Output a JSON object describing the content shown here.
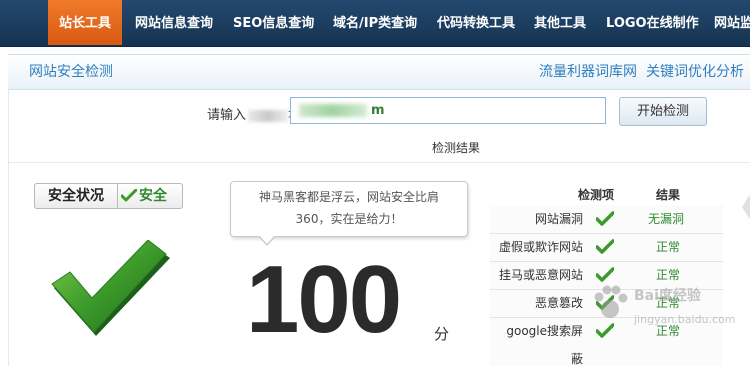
{
  "nav": {
    "items": [
      {
        "label": "站长工具",
        "active": true
      },
      {
        "label": "网站信息查询"
      },
      {
        "label": "SEO信息查询"
      },
      {
        "label": "域名/IP类查询"
      },
      {
        "label": "代码转换工具"
      },
      {
        "label": "其他工具"
      },
      {
        "label": "LOGO在线制作"
      },
      {
        "label": "网站监"
      }
    ]
  },
  "subhead": {
    "title": "网站安全检测",
    "links": [
      "流量利器词库网",
      "关键词优化分析"
    ]
  },
  "form": {
    "label_prefix": "请输入",
    "label_suffix": "址",
    "url_value": "m",
    "button": "开始检测",
    "result_heading": "检测结果"
  },
  "badge": {
    "label": "安全状况",
    "status": "安全"
  },
  "tooltip": {
    "line1": "神马黑客都是浮云，网站安全比肩",
    "line2": "360，实在是给力！"
  },
  "score": {
    "value": "100",
    "unit": "分"
  },
  "results": {
    "headers": [
      "检测项",
      "结果"
    ],
    "rows": [
      {
        "item": "网站漏洞",
        "result": "无漏洞"
      },
      {
        "item": "虚假或欺诈网站",
        "result": "正常"
      },
      {
        "item": "挂马或恶意网站",
        "result": "正常"
      },
      {
        "item": "恶意篡改",
        "result": "正常"
      },
      {
        "item": "google搜索屏",
        "result": "正常"
      }
    ],
    "overflow_text": "蔽"
  },
  "watermark": {
    "text": "Bai度经验",
    "sub": "jingyan.baidu.com"
  },
  "colors": {
    "nav_bg": "#1b3d5f",
    "nav_active": "#e8661d",
    "link": "#2f7fbf",
    "ok_green": "#2f8a2f"
  }
}
